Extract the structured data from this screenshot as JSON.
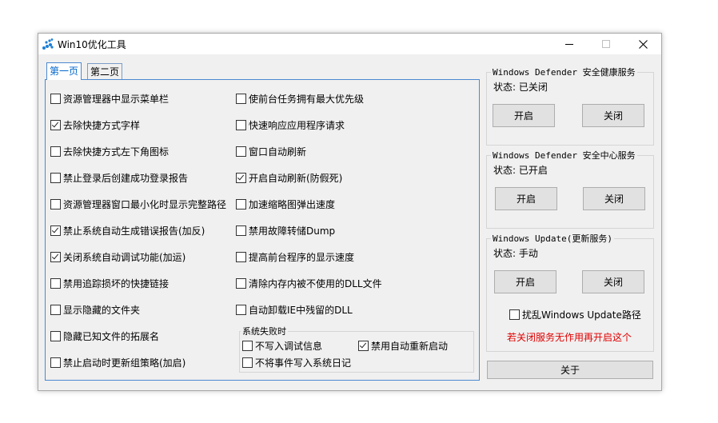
{
  "window": {
    "title": "Win10优化工具",
    "minimize": "–",
    "maximize": "□",
    "close": "✕"
  },
  "tabs": [
    {
      "label": "第一页",
      "active": true
    },
    {
      "label": "第二页",
      "active": false
    }
  ],
  "left_column": [
    {
      "label": "资源管理器中显示菜单栏",
      "checked": false
    },
    {
      "label": "去除快捷方式字样",
      "checked": true
    },
    {
      "label": "去除快捷方式左下角图标",
      "checked": false
    },
    {
      "label": "禁止登录后创建成功登录报告",
      "checked": false
    },
    {
      "label": "资源管理器窗口最小化时显示完整路径",
      "checked": false
    },
    {
      "label": "禁止系统自动生成错误报告(加反)",
      "checked": true
    },
    {
      "label": "关闭系统自动调试功能(加运)",
      "checked": true
    },
    {
      "label": "禁用追踪损坏的快捷链接",
      "checked": false
    },
    {
      "label": "显示隐藏的文件夹",
      "checked": false
    },
    {
      "label": "隐藏已知文件的拓展名",
      "checked": false
    },
    {
      "label": "禁止启动时更新组策略(加启)",
      "checked": false
    }
  ],
  "middle_column": [
    {
      "label": "使前台任务拥有最大优先级",
      "checked": false
    },
    {
      "label": "快速响应应用程序请求",
      "checked": false
    },
    {
      "label": "窗口自动刷新",
      "checked": false
    },
    {
      "label": "开启自动刷新(防假死)",
      "checked": true
    },
    {
      "label": "加速缩略图弹出速度",
      "checked": false
    },
    {
      "label": "禁用故障转储Dump",
      "checked": false
    },
    {
      "label": "提高前台程序的显示速度",
      "checked": false
    },
    {
      "label": "清除内存内被不使用的DLL文件",
      "checked": false
    },
    {
      "label": "自动卸载IE中残留的DLL",
      "checked": false
    }
  ],
  "system_failure": {
    "legend": "系统失败时",
    "options": [
      {
        "label": "不写入调试信息",
        "checked": false
      },
      {
        "label": "禁用自动重新启动",
        "checked": true
      },
      {
        "label": "不将事件写入系统日记",
        "checked": false
      }
    ]
  },
  "services": [
    {
      "legend": "Windows Defender 安全健康服务",
      "status": "状态: 已关闭",
      "start": "开启",
      "stop": "关闭"
    },
    {
      "legend": "Windows Defender 安全中心服务",
      "status": "状态: 已开启",
      "start": "开启",
      "stop": "关闭"
    },
    {
      "legend": "Windows Update(更新服务)",
      "status": "状态: 手动",
      "start": "开启",
      "stop": "关闭",
      "extra_option": {
        "label": "扰乱Windows Update路径",
        "checked": false
      },
      "warning": "若关闭服务无作用再开启这个"
    }
  ],
  "about_button": "关于",
  "colors": {
    "accent": "#4c88d0",
    "warning": "#e00000",
    "icon": "#1e7fd6"
  }
}
